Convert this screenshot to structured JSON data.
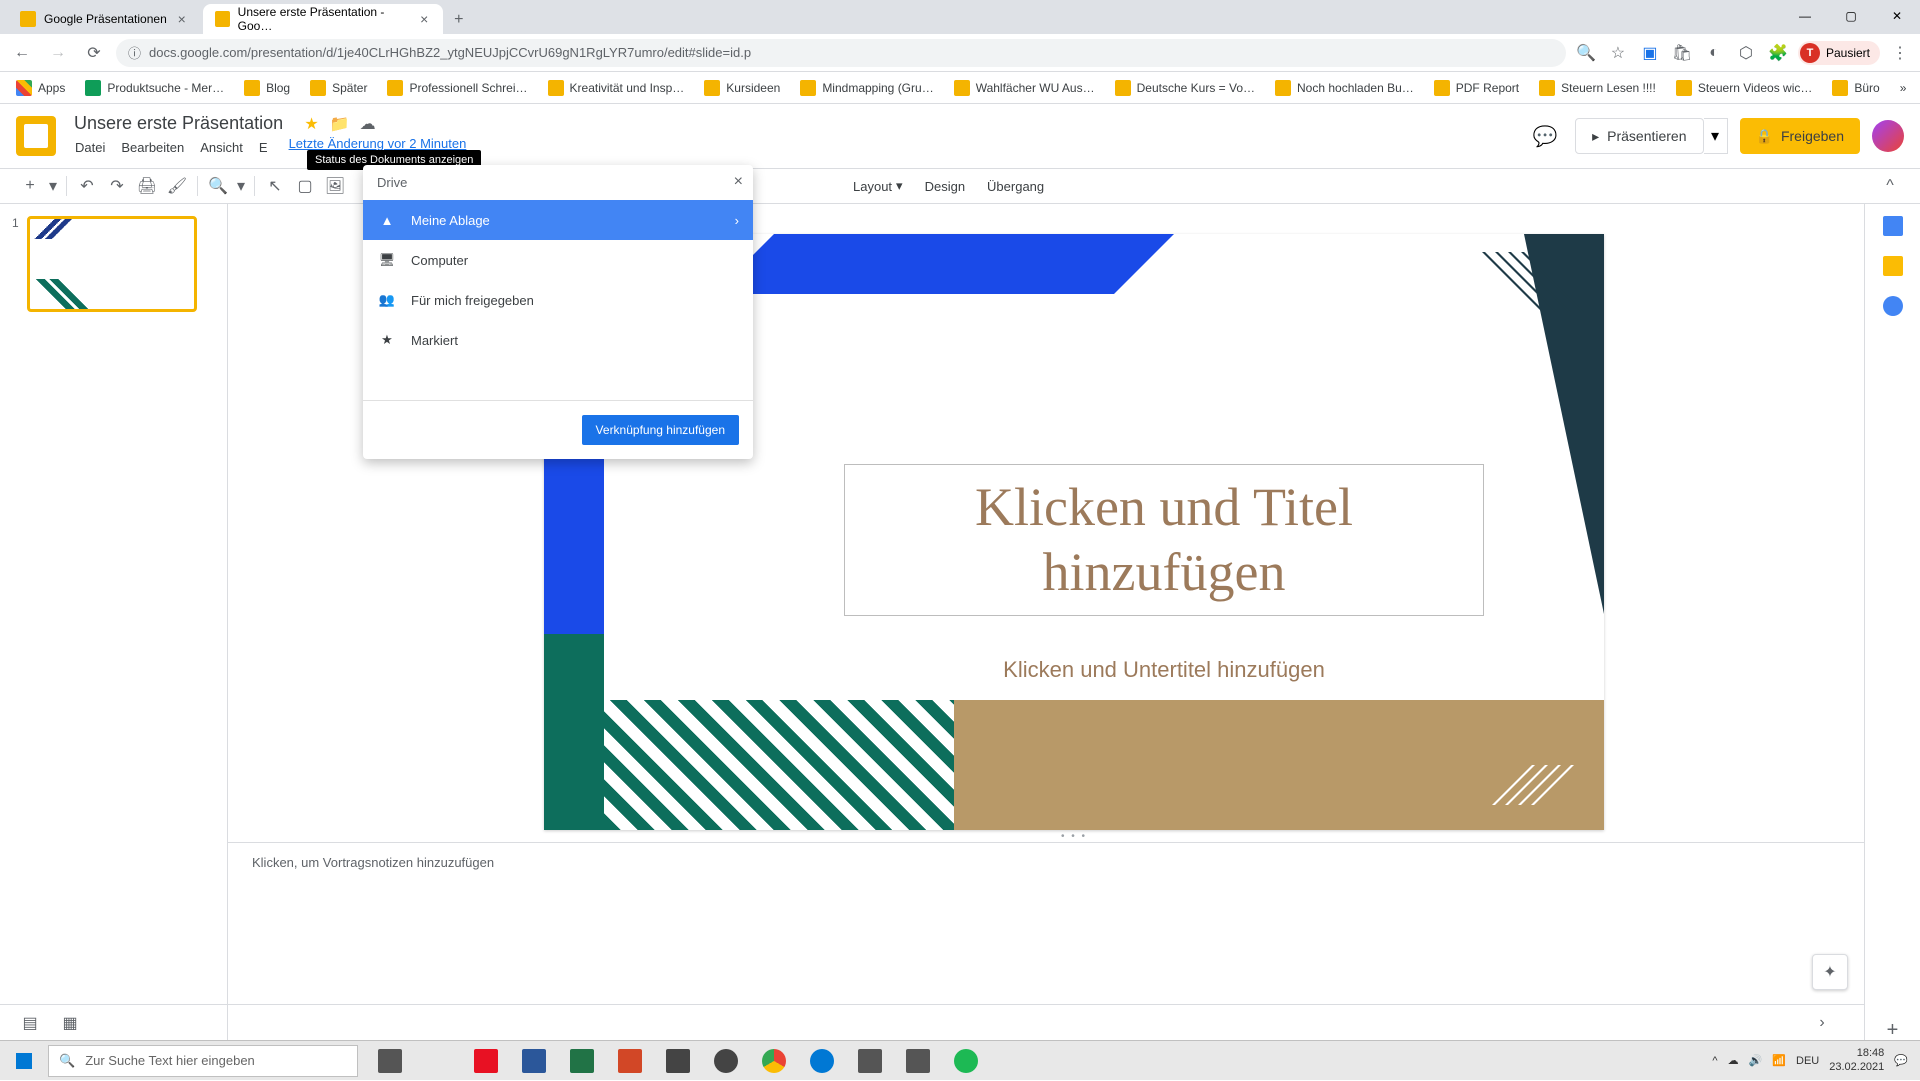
{
  "browser": {
    "tabs": [
      {
        "title": "Google Präsentationen",
        "favicon_color": "#f4b400"
      },
      {
        "title": "Unsere erste Präsentation - Goo…",
        "favicon_color": "#f4b400"
      }
    ],
    "url": "docs.google.com/presentation/d/1je40CLrHGhBZ2_ytgNEUJpjCCvrU69gN1RgLYR7umro/edit#slide=id.p",
    "profile": {
      "initial": "T",
      "status": "Pausiert"
    }
  },
  "bookmarks": [
    "Apps",
    "Produktsuche - Mer…",
    "Blog",
    "Später",
    "Professionell Schrei…",
    "Kreativität und Insp…",
    "Kursideen",
    "Mindmapping  (Gru…",
    "Wahlfächer WU Aus…",
    "Deutsche Kurs = Vo…",
    "Noch hochladen Bu…",
    "PDF Report",
    "Steuern Lesen !!!!",
    "Steuern Videos wic…",
    "Büro"
  ],
  "doc": {
    "title": "Unsere erste Präsentation",
    "tooltip": "Status des Dokuments anzeigen",
    "menus": [
      "Datei",
      "Bearbeiten",
      "Ansicht",
      "E"
    ],
    "last_edit": "Letzte Änderung vor 2 Minuten"
  },
  "header_buttons": {
    "present": "Präsentieren",
    "share": "Freigeben"
  },
  "toolbar": {
    "layout": "Layout",
    "design": "Design",
    "transition": "Übergang"
  },
  "popup": {
    "header": "Drive",
    "items": [
      {
        "label": "Meine Ablage",
        "icon": "drive-icon",
        "selected": true,
        "has_arrow": true
      },
      {
        "label": "Computer",
        "icon": "computer-icon",
        "selected": false,
        "has_arrow": false
      },
      {
        "label": "Für mich freigegeben",
        "icon": "shared-icon",
        "selected": false,
        "has_arrow": false
      },
      {
        "label": "Markiert",
        "icon": "star-icon",
        "selected": false,
        "has_arrow": false
      }
    ],
    "button": "Verknüpfung hinzufügen"
  },
  "slide": {
    "number": "1",
    "title_placeholder": "Klicken und Titel hinzufügen",
    "subtitle_placeholder": "Klicken und Untertitel hinzufügen"
  },
  "notes_placeholder": "Klicken, um Vortragsnotizen hinzuzufügen",
  "taskbar": {
    "search_placeholder": "Zur Suche Text hier eingeben",
    "lang": "DEU",
    "time": "18:48",
    "date": "23.02.2021",
    "task_colors": [
      "#0078d4",
      "#ffb900",
      "#e81123",
      "#2b579a",
      "#217346",
      "#d24726",
      "#444",
      "#444",
      "#4285f4",
      "#0078d4",
      "#555",
      "#555",
      "#1db954"
    ]
  }
}
